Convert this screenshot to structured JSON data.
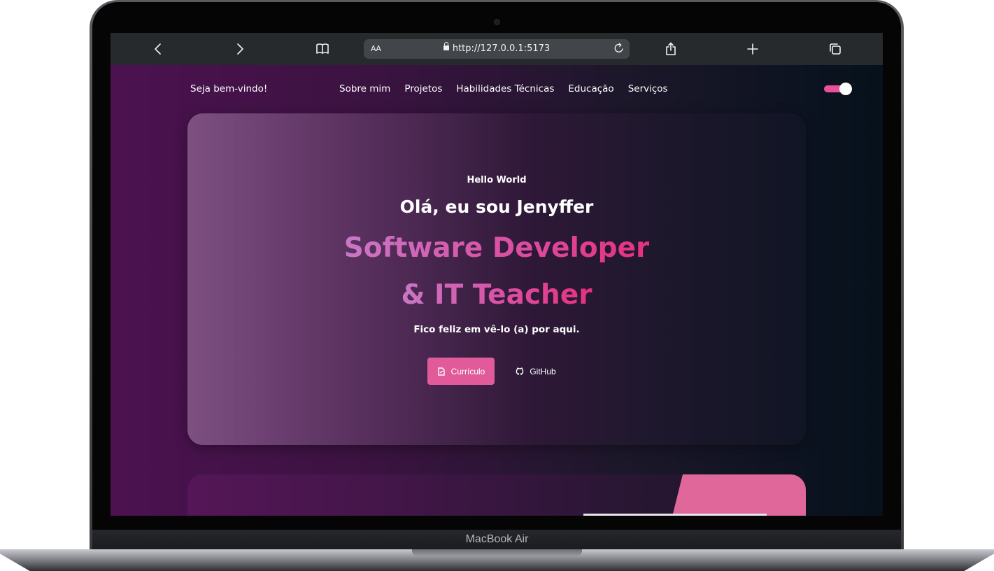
{
  "device": {
    "label": "MacBook Air"
  },
  "browser": {
    "text_size_label": "AA",
    "url": "http://127.0.0.1:5173",
    "icons": [
      "chevron-left-icon",
      "chevron-right-icon",
      "book-icon",
      "reload-icon",
      "share-icon",
      "plus-icon",
      "tabs-icon"
    ]
  },
  "nav": {
    "brand": "Seja bem-vindo!",
    "links": [
      "Sobre mim",
      "Projetos",
      "Habilidades Técnicas",
      "Educação",
      "Serviços"
    ],
    "theme_toggle_on": true
  },
  "hero": {
    "kicker": "Hello World",
    "title": "Olá, eu sou Jenyffer",
    "role_line1": "Software Developer",
    "role_line2": "& IT Teacher",
    "subtitle": "Fico feliz em vê-lo (a) por aqui.",
    "cv_button": "Currículo",
    "github_button": "GitHub"
  },
  "colors": {
    "accent": "#e15a9a",
    "gradient_start": "#c977c6",
    "gradient_end": "#e6307f",
    "page_left": "#4c1250",
    "page_right": "#06111c"
  }
}
